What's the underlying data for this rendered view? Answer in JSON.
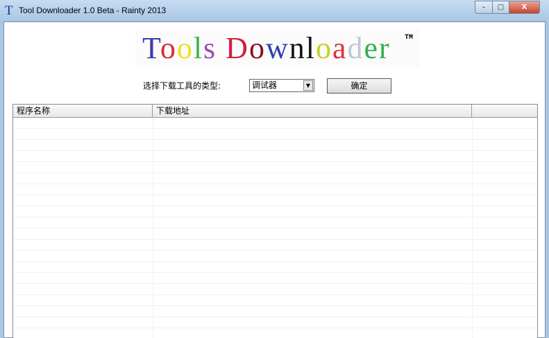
{
  "window": {
    "title": "Tool Downloader 1.0 Beta - Rainty 2013",
    "icon_letter": "T",
    "minimize": "–",
    "maximize": "□",
    "close": "X"
  },
  "logo": {
    "text": "Tools Downloader",
    "tm": "TM",
    "letters": [
      {
        "c": "T",
        "color": "#3b3bb0"
      },
      {
        "c": "o",
        "color": "#d62a36"
      },
      {
        "c": "o",
        "color": "#f0e020"
      },
      {
        "c": "l",
        "color": "#3cb44a"
      },
      {
        "c": "s",
        "color": "#9c4ab8"
      },
      {
        "c": " ",
        "color": "#000"
      },
      {
        "c": "D",
        "color": "#d01e3c"
      },
      {
        "c": "o",
        "color": "#8a1020"
      },
      {
        "c": "w",
        "color": "#3040b0"
      },
      {
        "c": "n",
        "color": "#111111"
      },
      {
        "c": "l",
        "color": "#111111"
      },
      {
        "c": "o",
        "color": "#c8d020"
      },
      {
        "c": "a",
        "color": "#e0303a"
      },
      {
        "c": "d",
        "color": "#c0c8d8"
      },
      {
        "c": "e",
        "color": "#30b050"
      },
      {
        "c": "r",
        "color": "#30b050"
      }
    ]
  },
  "form": {
    "type_label": "选择下载工具的类型:",
    "type_value": "调试器",
    "ok_label": "确定"
  },
  "table": {
    "columns": [
      "程序名称",
      "下载地址",
      ""
    ]
  }
}
